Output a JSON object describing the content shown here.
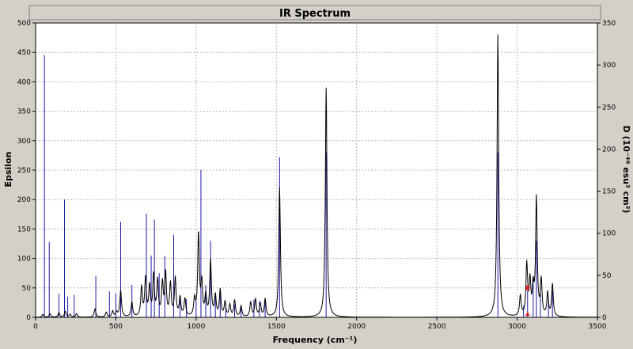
{
  "chart_data": {
    "type": "line",
    "title": "IR Spectrum",
    "xlabel": "Frequency (cm⁻¹)",
    "ylabel_left": "Epsilon",
    "ylabel_right": "D (10⁻⁴⁰ esu² cm²)",
    "xlim": [
      0,
      3500
    ],
    "ylim_left": [
      0,
      500
    ],
    "ylim_right": [
      0,
      350
    ],
    "x_ticks": [
      0,
      500,
      1000,
      1500,
      2000,
      2500,
      3000,
      3500
    ],
    "y_ticks_left": [
      0,
      50,
      100,
      150,
      200,
      250,
      300,
      350,
      400,
      450,
      500
    ],
    "y_ticks_right": [
      0,
      50,
      100,
      150,
      200,
      250,
      300,
      350
    ],
    "grid": true,
    "colors": {
      "spectrum": "#000000",
      "sticks": "#1a1aa6",
      "marker": "#e02020",
      "plot_bg": "#ffffff"
    },
    "series": [
      {
        "kind": "spectrum",
        "x": [
          45,
          90,
          145,
          185,
          215,
          255,
          370,
          440,
          480,
          505,
          530,
          600,
          660,
          685,
          710,
          735,
          760,
          790,
          810,
          840,
          870,
          900,
          930,
          990,
          1015,
          1035,
          1060,
          1090,
          1120,
          1150,
          1180,
          1210,
          1240,
          1280,
          1340,
          1370,
          1400,
          1430,
          1520,
          1810,
          2880,
          3020,
          3060,
          3080,
          3100,
          3120,
          3150,
          3190,
          3220
        ],
        "y": [
          5,
          6,
          8,
          10,
          5,
          6,
          14,
          8,
          10,
          8,
          45,
          25,
          50,
          65,
          50,
          70,
          60,
          55,
          72,
          55,
          65,
          32,
          30,
          28,
          140,
          55,
          35,
          95,
          35,
          45,
          25,
          20,
          28,
          18,
          25,
          30,
          22,
          30,
          220,
          390,
          480,
          35,
          88,
          58,
          45,
          200,
          60,
          40,
          55
        ]
      },
      {
        "kind": "sticks",
        "x": [
          55,
          85,
          145,
          180,
          200,
          240,
          375,
          460,
          500,
          530,
          600,
          690,
          720,
          740,
          770,
          805,
          860,
          900,
          940,
          1000,
          1030,
          1060,
          1090,
          1120,
          1150,
          1185,
          1240,
          1280,
          1360,
          1395,
          1430,
          1520,
          1810,
          2880,
          3040,
          3065,
          3100,
          3120,
          3145,
          3195,
          3220
        ],
        "y": [
          445,
          128,
          40,
          200,
          35,
          38,
          70,
          44,
          40,
          162,
          55,
          176,
          105,
          166,
          75,
          104,
          140,
          33,
          31,
          28,
          250,
          55,
          130,
          38,
          45,
          24,
          22,
          18,
          30,
          28,
          33,
          272,
          280,
          280,
          20,
          45,
          70,
          130,
          40,
          35,
          45
        ]
      }
    ]
  }
}
